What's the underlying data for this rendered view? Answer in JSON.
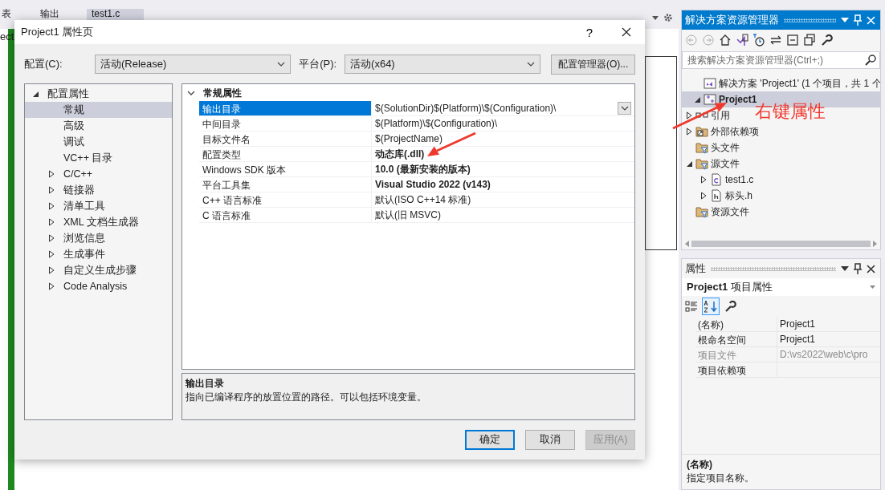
{
  "ide": {
    "tabs": [
      {
        "label": "表",
        "selected": false
      },
      {
        "label": "输出",
        "selected": false
      },
      {
        "label": "test1.c",
        "selected": true
      }
    ],
    "editor_fragment": "ect"
  },
  "dialog": {
    "title": "Project1 属性页",
    "help": "?",
    "configuration": {
      "label": "配置(C):",
      "value": "活动(Release)"
    },
    "platform": {
      "label": "平台(P):",
      "value": "活动(x64)"
    },
    "manager_button": "配置管理器(O)...",
    "tree": [
      {
        "label": "配置属性",
        "expanded": true,
        "selected": false,
        "children": [
          {
            "label": "常规",
            "selected": true
          },
          {
            "label": "高级",
            "selected": false
          },
          {
            "label": "调试",
            "selected": false
          },
          {
            "label": "VC++ 目录",
            "selected": false
          },
          {
            "label": "C/C++",
            "expanded": false,
            "selected": false
          },
          {
            "label": "链接器",
            "expanded": false,
            "selected": false
          },
          {
            "label": "清单工具",
            "expanded": false,
            "selected": false
          },
          {
            "label": "XML 文档生成器",
            "expanded": false,
            "selected": false
          },
          {
            "label": "浏览信息",
            "expanded": false,
            "selected": false
          },
          {
            "label": "生成事件",
            "expanded": false,
            "selected": false
          },
          {
            "label": "自定义生成步骤",
            "expanded": false,
            "selected": false
          },
          {
            "label": "Code Analysis",
            "expanded": false,
            "selected": false
          }
        ]
      }
    ],
    "grid": {
      "category": "常规属性",
      "expanded": true,
      "rows": [
        {
          "name": "输出目录",
          "value": "$(SolutionDir)$(Platform)\\$(Configuration)\\",
          "modified": false,
          "selected": true
        },
        {
          "name": "中间目录",
          "value": "$(Platform)\\$(Configuration)\\",
          "modified": false,
          "selected": false
        },
        {
          "name": "目标文件名",
          "value": "$(ProjectName)",
          "modified": false,
          "selected": false
        },
        {
          "name": "配置类型",
          "value": "动态库(.dll)",
          "modified": true,
          "selected": false
        },
        {
          "name": "Windows SDK 版本",
          "value": "10.0 (最新安装的版本)",
          "modified": true,
          "selected": false
        },
        {
          "name": "平台工具集",
          "value": "Visual Studio 2022 (v143)",
          "modified": true,
          "selected": false
        },
        {
          "name": "C++ 语言标准",
          "value": "默认(ISO C++14 标准)",
          "modified": false,
          "selected": false
        },
        {
          "name": "C 语言标准",
          "value": "默认(旧 MSVC)",
          "modified": false,
          "selected": false
        }
      ]
    },
    "description": {
      "title": "输出目录",
      "text": "指向已编译程序的放置位置的路径。可以包括环境变量。"
    },
    "buttons": [
      {
        "label": "确定",
        "default": true,
        "disabled": false
      },
      {
        "label": "取消",
        "default": false,
        "disabled": false
      },
      {
        "label": "应用(A)",
        "default": false,
        "disabled": true
      }
    ]
  },
  "solution_explorer": {
    "title": "解决方案资源管理器",
    "search": {
      "placeholder": "搜索解决方案资源管理器(Ctrl+;)"
    },
    "tree": [
      {
        "label": "解决方案 'Project1' (1 个项目，共 1 个",
        "kind": "solution",
        "selected": false,
        "children": [
          {
            "label": "Project1",
            "kind": "project",
            "expanded": true,
            "selected": true,
            "children": [
              {
                "label": "引用",
                "kind": "references",
                "expanded": false,
                "selected": false
              },
              {
                "label": "外部依赖项",
                "kind": "external",
                "expanded": false,
                "selected": false
              },
              {
                "label": "头文件",
                "kind": "filter",
                "selected": false
              },
              {
                "label": "源文件",
                "kind": "filter",
                "expanded": true,
                "selected": false,
                "children": [
                  {
                    "label": "test1.c",
                    "kind": "c-file",
                    "expanded": false,
                    "selected": false
                  },
                  {
                    "label": "标头.h",
                    "kind": "h-file",
                    "expanded": false,
                    "selected": false
                  }
                ]
              },
              {
                "label": "资源文件",
                "kind": "filter",
                "selected": false
              }
            ]
          }
        ]
      }
    ]
  },
  "properties": {
    "title": "属性",
    "object": "**Project1** 项目属性",
    "rows": [
      {
        "name": "(名称)",
        "value": "Project1",
        "disabled": false
      },
      {
        "name": "根命名空间",
        "value": "Project1",
        "disabled": false
      },
      {
        "name": "项目文件",
        "value": "D:\\vs2022\\web\\c\\pro",
        "disabled": true
      },
      {
        "name": "项目依赖项",
        "value": "",
        "disabled": false
      }
    ],
    "description": {
      "title": "(名称)",
      "text": "指定项目名称。"
    }
  },
  "annotation": {
    "text": "右键属性"
  }
}
